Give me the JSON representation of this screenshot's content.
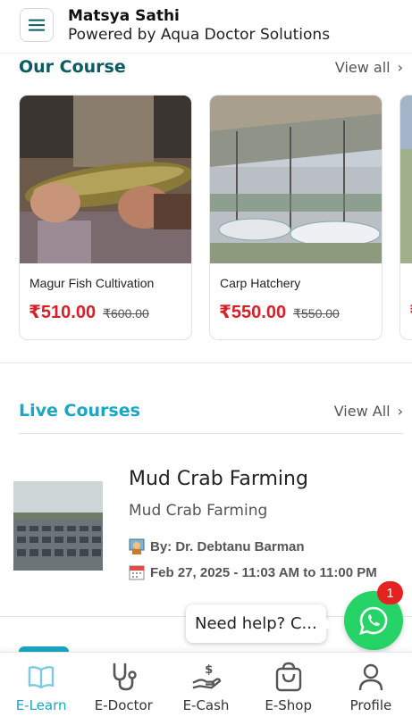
{
  "header": {
    "title": "Matsya Sathi",
    "subtitle": "Powered by Aqua Doctor Solutions",
    "menu_icon": "hamburger-icon"
  },
  "our_course": {
    "title": "Our Course",
    "view_all": "View all",
    "cards": [
      {
        "name": "Magur Fish Cultivation",
        "price": "₹510.00",
        "old_price": "₹600.00"
      },
      {
        "name": "Carp Hatchery",
        "price": "₹550.00",
        "old_price": "₹550.00"
      }
    ]
  },
  "live_courses": {
    "title": "Live Courses",
    "view_all": "View All",
    "item": {
      "title": "Mud Crab Farming",
      "subtitle": "Mud Crab Farming",
      "by": "By: Dr. Debtanu Barman",
      "date": "Feb 27, 2025 - 11:03 AM to 11:00 PM"
    }
  },
  "help": {
    "text": "Need help? C...",
    "badge": "1"
  },
  "nav": {
    "items": [
      {
        "label": "E-Learn",
        "icon": "book-icon"
      },
      {
        "label": "E-Doctor",
        "icon": "stethoscope-icon"
      },
      {
        "label": "E-Cash",
        "icon": "cash-hand-icon"
      },
      {
        "label": "E-Shop",
        "icon": "shopping-bag-icon"
      },
      {
        "label": "Profile",
        "icon": "user-icon"
      }
    ],
    "active_color": "#1aa6c4"
  },
  "colors": {
    "price_red": "#d8202a",
    "dark_teal": "#0b5b63",
    "light_teal": "#1aa6c4",
    "whatsapp_green": "#25d366"
  }
}
